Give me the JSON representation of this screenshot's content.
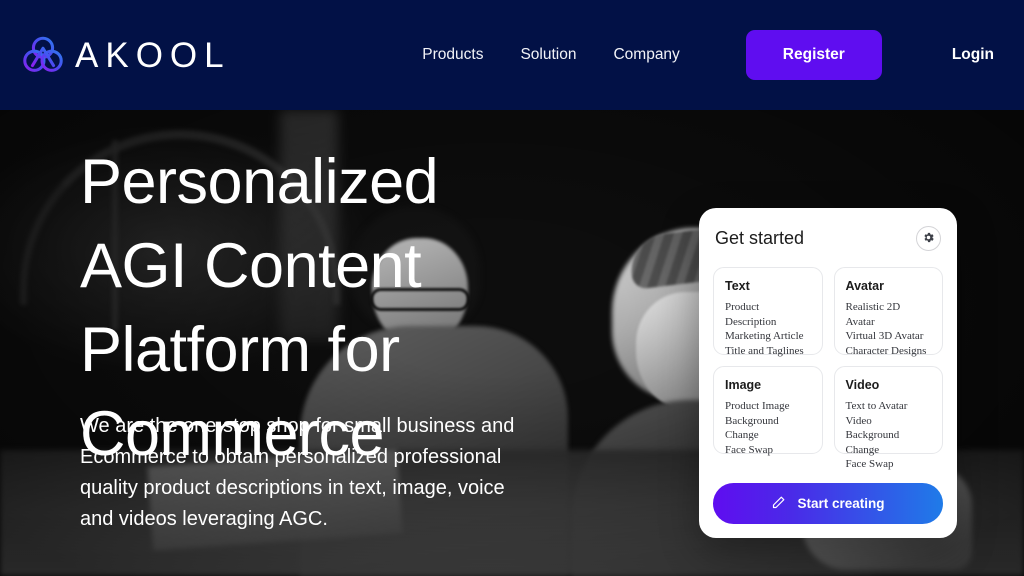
{
  "navbar": {
    "logo_icon": "akool-trefoil-logo-icon",
    "brand": "AKOOL",
    "links": [
      {
        "label": "Products"
      },
      {
        "label": "Solution"
      },
      {
        "label": "Company"
      }
    ],
    "register_label": "Register",
    "login_label": "Login",
    "background_color": "#021146",
    "register_color": "#5F0DF0"
  },
  "hero": {
    "headline_lines": [
      "Personalized",
      "AGI Content",
      "Platform for",
      "Commerce"
    ],
    "subcopy": "We are the one-stop shop for small business and Ecommerce to obtain personalized professional quality product descriptions in text, image, voice and videos leveraging AGC.",
    "background_image": "grayscale-photo-of-two-women-working-at-a-desk"
  },
  "card": {
    "title": "Get started",
    "settings_icon": "gear-icon",
    "tiles": [
      {
        "title": "Text",
        "items": [
          "Product Description",
          "Marketing Article",
          "Title and Taglines"
        ]
      },
      {
        "title": "Avatar",
        "items": [
          "Realistic 2D Avatar",
          "Virtual 3D Avatar",
          "Character Designs"
        ]
      },
      {
        "title": "Image",
        "items": [
          "Product Image",
          "Background Change",
          "Face Swap"
        ]
      },
      {
        "title": "Video",
        "items": [
          "Text to Avatar Video",
          "Background Change",
          "Face Swap"
        ]
      }
    ],
    "cta_label": "Start creating",
    "cta_icon": "pencil-icon",
    "cta_gradient_from": "#5F0DF0",
    "cta_gradient_to": "#1F7BE8"
  }
}
